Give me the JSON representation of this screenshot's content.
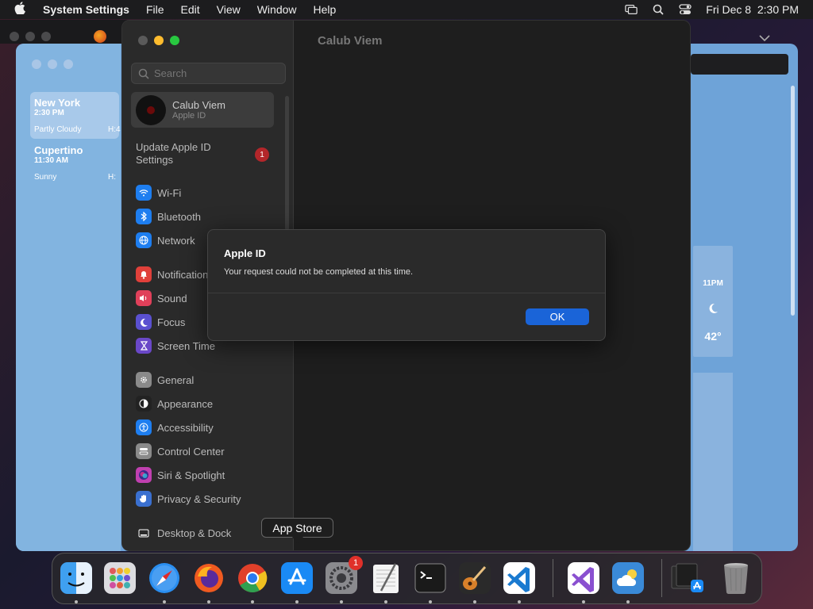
{
  "menubar": {
    "app_name": "System Settings",
    "menus": [
      "File",
      "Edit",
      "View",
      "Window",
      "Help"
    ],
    "clock": "Fri Dec 8  2:30 PM"
  },
  "weather": {
    "cities": [
      {
        "name": "New York",
        "time": "2:30 PM",
        "condition": "Partly Cloudy",
        "extra": "H:4"
      },
      {
        "name": "Cupertino",
        "time": "11:30 AM",
        "condition": "Sunny",
        "extra": "H:"
      }
    ],
    "hour_label": "11PM",
    "temp": "42°"
  },
  "settings": {
    "pane_title": "Calub Viem",
    "search_placeholder": "Search",
    "account_name": "Calub Viem",
    "account_sub": "Apple ID",
    "update_label": "Update Apple ID Settings",
    "update_badge": "1",
    "groups": [
      [
        {
          "label": "Wi-Fi",
          "icon": "wifi-icon",
          "color": "#1e7ef0"
        },
        {
          "label": "Bluetooth",
          "icon": "bluetooth-icon",
          "color": "#1e7ef0"
        },
        {
          "label": "Network",
          "icon": "globe-icon",
          "color": "#1e7ef0"
        }
      ],
      [
        {
          "label": "Notifications",
          "icon": "bell-icon",
          "color": "#e0403a"
        },
        {
          "label": "Sound",
          "icon": "speaker-icon",
          "color": "#e0405a"
        },
        {
          "label": "Focus",
          "icon": "moon-icon",
          "color": "#5a50d0"
        },
        {
          "label": "Screen Time",
          "icon": "hourglass-icon",
          "color": "#6a48c8"
        }
      ],
      [
        {
          "label": "General",
          "icon": "gear-icon",
          "color": "#8a8a8a"
        },
        {
          "label": "Appearance",
          "icon": "appearance-icon",
          "color": "#222222"
        },
        {
          "label": "Accessibility",
          "icon": "accessibility-icon",
          "color": "#1e7ef0"
        },
        {
          "label": "Control Center",
          "icon": "control-center-icon",
          "color": "#8a8a8a"
        },
        {
          "label": "Siri & Spotlight",
          "icon": "siri-icon",
          "color": "#c040b0"
        },
        {
          "label": "Privacy & Security",
          "icon": "hand-icon",
          "color": "#3a70d0"
        }
      ],
      [
        {
          "label": "Desktop & Dock",
          "icon": "dock-icon",
          "color": "#2a2a2a"
        }
      ]
    ]
  },
  "dialog": {
    "title": "Apple ID",
    "message": "Your request could not be completed at this time.",
    "ok_label": "OK"
  },
  "tooltip": "App Store",
  "dock": {
    "apps": [
      {
        "name": "Finder",
        "icon": "finder-icon",
        "color": "#3fa0f0"
      },
      {
        "name": "Launchpad",
        "icon": "launchpad-icon",
        "color": "#d8d8dc"
      },
      {
        "name": "Safari",
        "icon": "safari-icon",
        "color": "#2a8ef0"
      },
      {
        "name": "Firefox",
        "icon": "firefox-icon",
        "color": "#f05a20"
      },
      {
        "name": "Chrome",
        "icon": "chrome-icon",
        "color": "#ffffff"
      },
      {
        "name": "App Store",
        "icon": "app-store-icon",
        "color": "#1a8af5"
      },
      {
        "name": "System Settings",
        "icon": "system-settings-icon",
        "color": "#8a8a8e",
        "badge": "1"
      },
      {
        "name": "TextEdit",
        "icon": "textedit-icon",
        "color": "#f0f0f0"
      },
      {
        "name": "Terminal",
        "icon": "terminal-icon",
        "color": "#1a1a1a"
      },
      {
        "name": "GarageBand",
        "icon": "guitar-icon",
        "color": "#2a2a2a"
      },
      {
        "name": "VS Code",
        "icon": "vscode-icon",
        "color": "#ffffff"
      },
      {
        "name": "Visual Studio",
        "icon": "visual-studio-icon",
        "color": "#ffffff"
      },
      {
        "name": "Weather",
        "icon": "weather-icon",
        "color": "#3a8ad8"
      },
      {
        "name": "Downloads",
        "icon": "downloads-stack-icon",
        "color": "#1a1a1a"
      },
      {
        "name": "Trash",
        "icon": "trash-icon",
        "color": "#aaaaaa"
      }
    ]
  }
}
